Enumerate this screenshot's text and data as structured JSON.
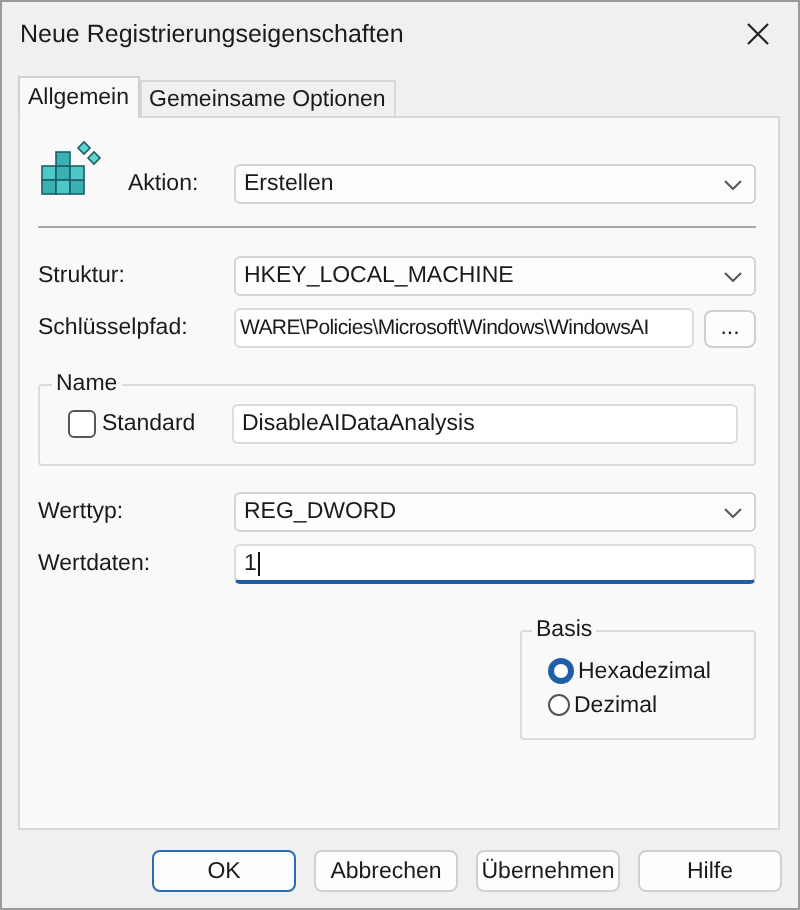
{
  "window": {
    "title": "Neue Registrierungseigenschaften"
  },
  "tabs": [
    {
      "label": "Allgemein",
      "selected": true
    },
    {
      "label": "Gemeinsame Optionen",
      "selected": false
    }
  ],
  "action": {
    "label": "Aktion:",
    "value": "Erstellen"
  },
  "structure": {
    "label": "Struktur:",
    "value": "HKEY_LOCAL_MACHINE"
  },
  "key_path": {
    "label": "Schlüsselpfad:",
    "value": "WARE\\Policies\\Microsoft\\Windows\\WindowsAI",
    "browse": "..."
  },
  "name": {
    "title": "Name",
    "default_checkbox": {
      "label": "Standard",
      "checked": false
    },
    "value": "DisableAIDataAnalysis"
  },
  "value_type": {
    "label": "Werttyp:",
    "value": "REG_DWORD"
  },
  "value_data": {
    "label": "Wertdaten:",
    "value": "1"
  },
  "basis": {
    "title": "Basis",
    "options": [
      {
        "label": "Hexadezimal",
        "selected": true
      },
      {
        "label": "Dezimal",
        "selected": false
      }
    ]
  },
  "buttons": [
    {
      "label": "OK",
      "default": true
    },
    {
      "label": "Abbrechen",
      "default": false
    },
    {
      "label": "Übernehmen",
      "default": false
    },
    {
      "label": "Hilfe",
      "default": false
    }
  ]
}
